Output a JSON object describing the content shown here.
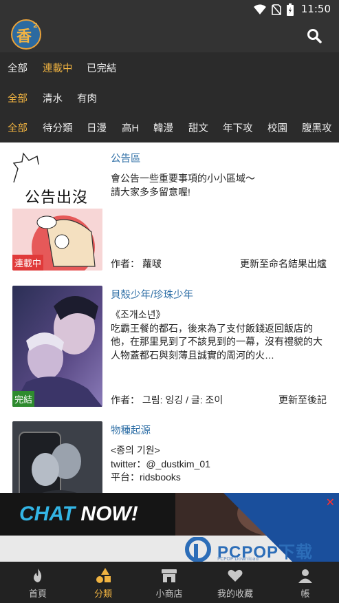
{
  "status_bar": {
    "time": "11:50"
  },
  "filters": {
    "status": [
      {
        "label": "全部",
        "active": false
      },
      {
        "label": "連載中",
        "active": true
      },
      {
        "label": "已完結",
        "active": false
      }
    ],
    "type": [
      {
        "label": "全部",
        "active": true
      },
      {
        "label": "清水",
        "active": false
      },
      {
        "label": "有肉",
        "active": false
      }
    ],
    "genre": [
      {
        "label": "全部",
        "active": true
      },
      {
        "label": "待分類",
        "active": false
      },
      {
        "label": "日漫",
        "active": false
      },
      {
        "label": "高H",
        "active": false
      },
      {
        "label": "韓漫",
        "active": false
      },
      {
        "label": "甜文",
        "active": false
      },
      {
        "label": "年下攻",
        "active": false
      },
      {
        "label": "校園",
        "active": false
      },
      {
        "label": "腹黑攻",
        "active": false
      }
    ]
  },
  "items": [
    {
      "title": "公告區",
      "description": "會公告一些重要事項的小小區域～\n請大家多多留意喔!",
      "author": "作者：  蘿啵",
      "update": "更新至命名結果出爐",
      "badge": "連載中",
      "badge_color": "#e03a3a",
      "cover_text": "公告出沒"
    },
    {
      "title": "貝殼少年/珍珠少年",
      "description": "《조개소년》\n吃霸王餐的都石，後來為了支付飯錢返回飯店的他，在那里見到了不該見到的一幕，沒有禮貌的大人物蓋都石與刻薄且誠實的周河的火…",
      "author": "作者：  그림: 잉깅 / 글: 조이",
      "update": "更新至後記",
      "badge": "完結",
      "badge_color": "#2e8b2e"
    },
    {
      "title": "物種起源",
      "description": "<종의 기원>\ntwitter：@_dustkim_01\n平台：ridsbooks\n…",
      "author": "",
      "update": ""
    }
  ],
  "ad": {
    "headline_part1": "CHAT",
    "headline_part2": " NOW!",
    "close": "✕",
    "watermark": "PCPOP下载",
    "watermark_sub": "PCPOP Download"
  },
  "bottom_nav": [
    {
      "label": "首頁",
      "icon": "flame-icon",
      "active": false
    },
    {
      "label": "分類",
      "icon": "shapes-icon",
      "active": true
    },
    {
      "label": "小商店",
      "icon": "shop-icon",
      "active": false
    },
    {
      "label": "我的收藏",
      "icon": "heart-icon",
      "active": false
    },
    {
      "label": "帳",
      "icon": "user-icon",
      "active": false
    }
  ],
  "colors": {
    "accent": "#f0b341",
    "link": "#2f6fa6",
    "bar": "#2b2b2b"
  }
}
